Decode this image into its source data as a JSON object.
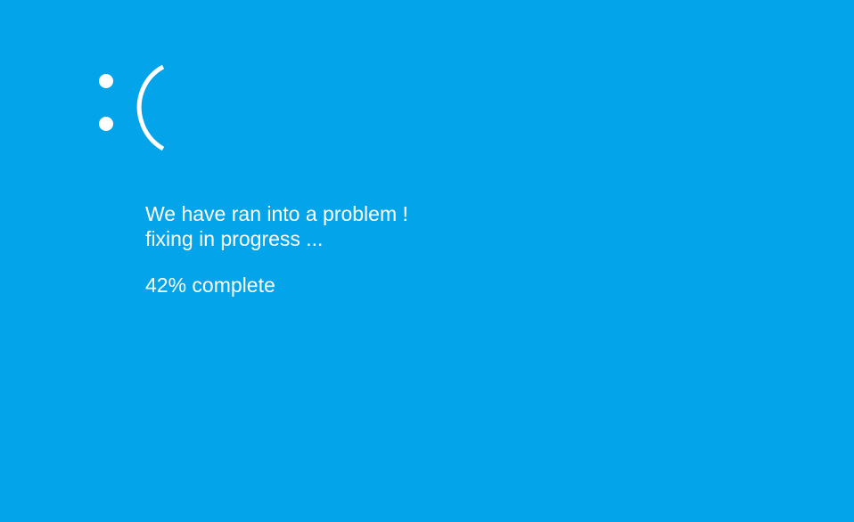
{
  "screen": {
    "background_color": "#03A4E9",
    "text_color": "#FFFFFF",
    "icon": "sad-face-icon",
    "message_line_1": "We have ran into a problem !",
    "message_line_2": "fixing in progress ...",
    "progress_text": "42% complete",
    "progress_percent": 42
  }
}
